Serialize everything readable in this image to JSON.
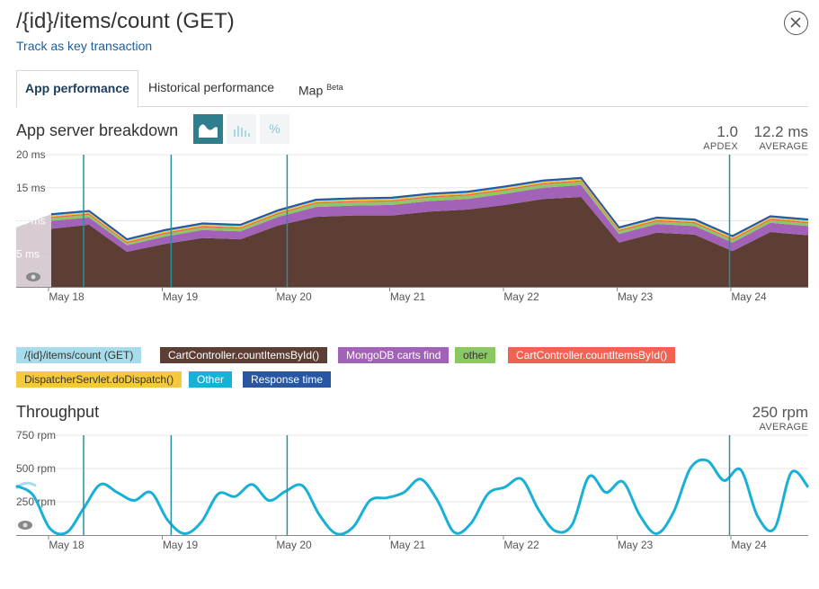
{
  "header": {
    "title": "/{id}/items/count (GET)",
    "track_link": "Track as key transaction"
  },
  "tabs": [
    {
      "label": "App performance",
      "active": true
    },
    {
      "label": "Historical performance",
      "active": false
    },
    {
      "label": "Map",
      "sup": "Beta",
      "active": false
    }
  ],
  "breakdown": {
    "title": "App server breakdown",
    "view_toggle": {
      "percent_label": "%"
    },
    "apdex": {
      "value": "1.0",
      "label": "APDEX"
    },
    "average": {
      "value": "12.2 ms",
      "label": "AVERAGE"
    }
  },
  "legend": [
    {
      "label": "/{id}/items/count (GET)",
      "color": "#a7dcea",
      "text": "#333333"
    },
    {
      "label": "CartController.countItemsById()",
      "color": "#5c3e35",
      "text": "#ffffff"
    },
    {
      "label": "MongoDB carts find",
      "color": "#a262b7",
      "text": "#ffffff"
    },
    {
      "label": "other",
      "color": "#8cc862",
      "text": "#333333"
    },
    {
      "label": "CartController.countItemsById()",
      "color": "#f06352",
      "text": "#ffffff"
    },
    {
      "label": "DispatcherServlet.doDispatch()",
      "color": "#f5c93d",
      "text": "#333333"
    },
    {
      "label": "Other",
      "color": "#17b0d6",
      "text": "#ffffff"
    },
    {
      "label": "Response time",
      "color": "#2856a3",
      "text": "#ffffff"
    }
  ],
  "throughput": {
    "title": "Throughput",
    "average": {
      "value": "250 rpm",
      "label": "AVERAGE"
    }
  },
  "chart_data": [
    {
      "type": "area",
      "title": "App server breakdown",
      "x_ticks": [
        "May 18",
        "May 19",
        "May 20",
        "May 21",
        "May 22",
        "May 23",
        "May 24"
      ],
      "y_ticks": [
        "20 ms",
        "15 ms",
        "10 ms",
        "5 ms"
      ],
      "ylim": [
        0,
        20
      ],
      "series": [
        {
          "name": "CartController.countItemsById()",
          "color": "#5c3e35",
          "values": [
            8.8,
            9.4,
            5.3,
            6.5,
            7.4,
            7.2,
            9.3,
            10.6,
            10.8,
            10.8,
            11.4,
            11.7,
            12.4,
            13.3,
            13.6,
            6.7,
            8.2,
            7.9,
            5.4,
            8.3,
            7.8
          ]
        },
        {
          "name": "MongoDB carts find",
          "color": "#a262b7",
          "values": [
            1.2,
            1.1,
            1.0,
            1.1,
            1.2,
            1.2,
            1.3,
            1.5,
            1.5,
            1.6,
            1.6,
            1.6,
            1.7,
            1.7,
            1.8,
            1.3,
            1.3,
            1.3,
            1.3,
            1.4,
            1.4
          ]
        },
        {
          "name": "other",
          "color": "#8cc862",
          "values": [
            0.4,
            0.4,
            0.3,
            0.4,
            0.4,
            0.4,
            0.4,
            0.5,
            0.5,
            0.5,
            0.5,
            0.5,
            0.5,
            0.5,
            0.5,
            0.4,
            0.4,
            0.4,
            0.4,
            0.4,
            0.4
          ]
        },
        {
          "name": "CartController.countItemsById()",
          "color": "#f06352",
          "values": [
            0.2,
            0.2,
            0.2,
            0.2,
            0.2,
            0.2,
            0.2,
            0.2,
            0.2,
            0.2,
            0.2,
            0.2,
            0.2,
            0.2,
            0.2,
            0.2,
            0.2,
            0.2,
            0.2,
            0.2,
            0.2
          ]
        },
        {
          "name": "DispatcherServlet.doDispatch()",
          "color": "#f5c93d",
          "values": [
            0.2,
            0.2,
            0.2,
            0.2,
            0.2,
            0.2,
            0.2,
            0.2,
            0.2,
            0.2,
            0.2,
            0.2,
            0.2,
            0.2,
            0.2,
            0.2,
            0.2,
            0.2,
            0.2,
            0.2,
            0.2
          ]
        },
        {
          "name": "Other",
          "color": "#17b0d6",
          "values": [
            0.1,
            0.1,
            0.1,
            0.1,
            0.1,
            0.1,
            0.1,
            0.1,
            0.1,
            0.1,
            0.1,
            0.1,
            0.1,
            0.1,
            0.1,
            0.1,
            0.1,
            0.1,
            0.1,
            0.1,
            0.1
          ]
        }
      ],
      "deployment_markers": [
        0.15,
        0.92,
        1.94,
        5.83,
        6.93
      ]
    },
    {
      "type": "line",
      "title": "Throughput",
      "x_ticks": [
        "May 18",
        "May 19",
        "May 20",
        "May 21",
        "May 22",
        "May 23",
        "May 24"
      ],
      "y_ticks": [
        "750 rpm",
        "500 rpm",
        "250 rpm"
      ],
      "ylim": [
        0,
        750
      ],
      "series": [
        {
          "name": "Throughput",
          "color": "#17b0d6",
          "values": [
            370,
            300,
            50,
            20,
            200,
            380,
            320,
            260,
            320,
            110,
            10,
            100,
            310,
            290,
            380,
            260,
            330,
            370,
            150,
            10,
            60,
            260,
            280,
            320,
            420,
            260,
            20,
            90,
            310,
            360,
            420,
            190,
            30,
            80,
            440,
            320,
            400,
            150,
            10,
            170,
            500,
            560,
            410,
            490,
            140,
            50,
            470,
            360
          ]
        }
      ],
      "deployment_markers": [
        0.15,
        0.92,
        1.94,
        5.83,
        6.93
      ]
    }
  ]
}
